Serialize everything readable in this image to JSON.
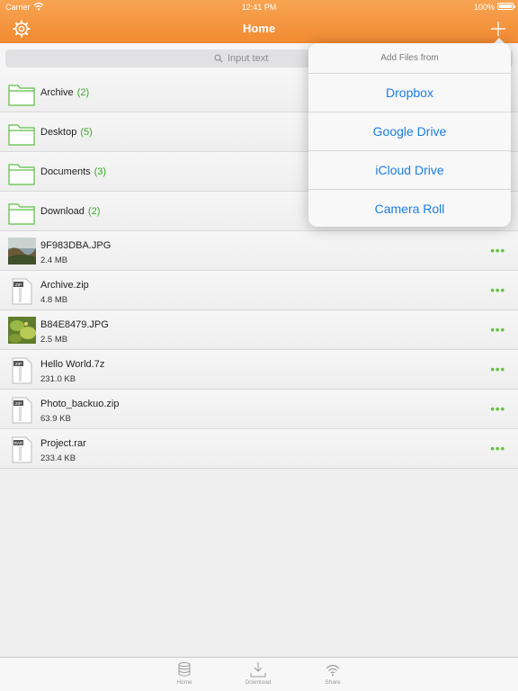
{
  "status_bar": {
    "carrier": "Carrier",
    "time": "12:41 PM",
    "battery": "100%"
  },
  "nav": {
    "title": "Home",
    "left_icon": "gear-icon",
    "right_icon": "plus-icon"
  },
  "search": {
    "placeholder": "Input text"
  },
  "folders": [
    {
      "name": "Archive",
      "count": "(2)"
    },
    {
      "name": "Desktop",
      "count": "(5)"
    },
    {
      "name": "Documents",
      "count": "(3)"
    },
    {
      "name": "Download",
      "count": "(2)"
    }
  ],
  "files": [
    {
      "name": "9F983DBA.JPG",
      "size": "2.4 MB",
      "kind": "image"
    },
    {
      "name": "Archive.zip",
      "size": "4.8 MB",
      "kind": "zip"
    },
    {
      "name": "B84E8479.JPG",
      "size": "2.5 MB",
      "kind": "image"
    },
    {
      "name": "Hello World.7z",
      "size": "231.0 KB",
      "kind": "zip"
    },
    {
      "name": "Photo_backuo.zip",
      "size": "63.9 KB",
      "kind": "zip"
    },
    {
      "name": "Project.rar",
      "size": "233.4 KB",
      "kind": "rar"
    }
  ],
  "popover": {
    "title": "Add Files from",
    "items": [
      "Dropbox",
      "Google Drive",
      "iCloud Drive",
      "Camera Roll"
    ]
  },
  "tabbar": {
    "tabs": [
      {
        "label": "Home",
        "icon": "database-icon"
      },
      {
        "label": "Download",
        "icon": "download-icon"
      },
      {
        "label": "Share",
        "icon": "wifi-icon"
      }
    ]
  },
  "colors": {
    "accent": "#f28a33",
    "link": "#1a7ee3",
    "green": "#3aa62a"
  }
}
